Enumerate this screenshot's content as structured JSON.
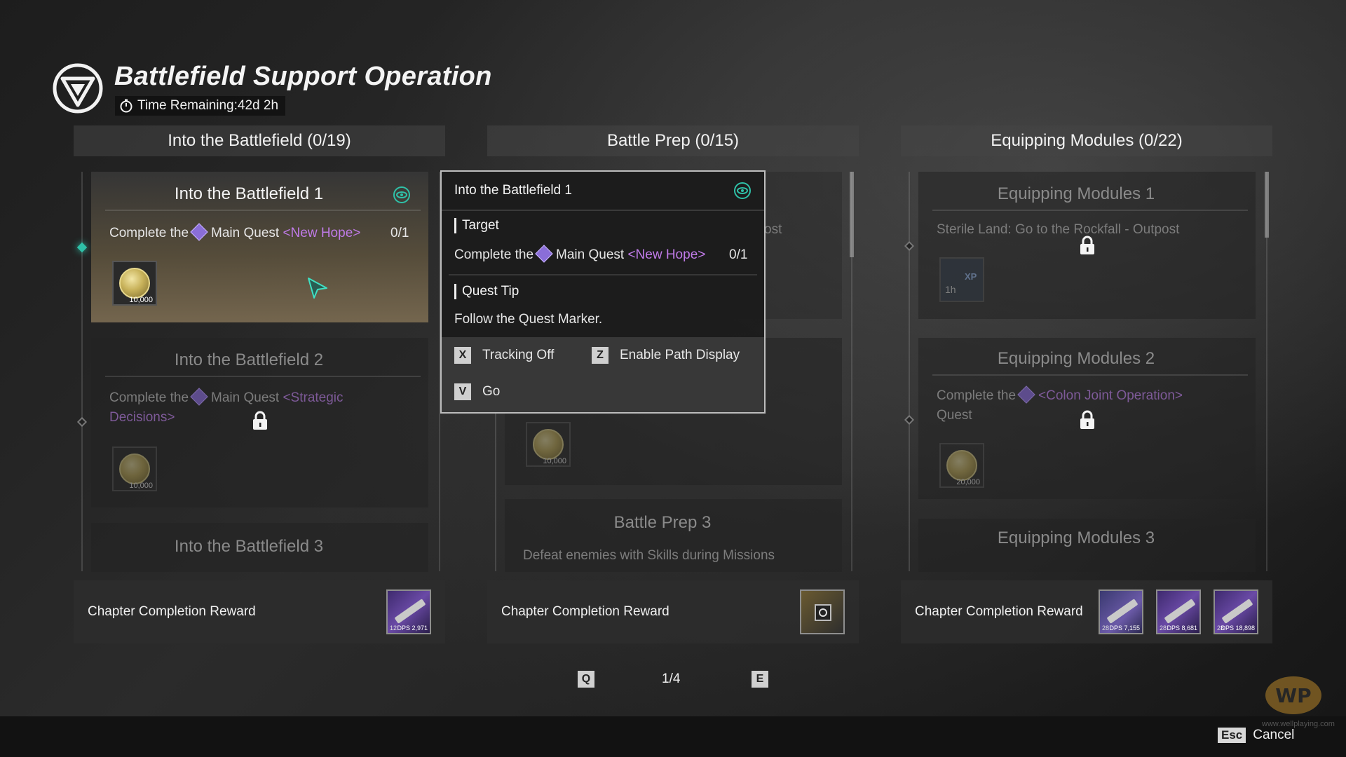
{
  "header": {
    "title": "Battlefield Support Operation",
    "time_remaining": "Time Remaining:42d 2h"
  },
  "columns": [
    {
      "title": "Into the Battlefield  (0/19)",
      "cards": [
        {
          "title": "Into the Battlefield 1",
          "desc_prefix": "Complete the",
          "quest_type": "Main Quest",
          "quest_name": "<New Hope>",
          "progress": "0/1",
          "reward_amount": "10,000"
        },
        {
          "title": "Into the Battlefield 2",
          "desc_prefix": "Complete the",
          "quest_type": "Main Quest",
          "quest_name": "<Strategic",
          "quest_name_2": "Decisions>",
          "reward_amount": "10,000"
        },
        {
          "title": "Into the Battlefield 3"
        }
      ],
      "reward_label": "Chapter Completion Reward",
      "reward_items": [
        {
          "level": "12",
          "dps": "DPS 2,971",
          "color": "#6a4aa6"
        }
      ]
    },
    {
      "title": "Battle Prep  (0/15)",
      "cards": [
        {
          "desc_fragment": "ost",
          "reward_amount": "10,000"
        },
        {
          "title": "Battle Prep 3",
          "desc": "Defeat enemies with Skills during Missions"
        }
      ],
      "reward_label": "Chapter Completion Reward"
    },
    {
      "title": "Equipping Modules  (0/22)",
      "cards": [
        {
          "title": "Equipping Modules 1",
          "desc": "Sterile Land: Go to the Rockfall - Outpost",
          "reward_time": "1h",
          "reward_tag": "XP"
        },
        {
          "title": "Equipping Modules 2",
          "desc_prefix": "Complete the",
          "quest_name": "<Colon Joint Operation>",
          "desc_suffix": "Quest",
          "reward_amount": "20,000"
        },
        {
          "title": "Equipping Modules 3"
        }
      ],
      "reward_label": "Chapter Completion Reward",
      "reward_items": [
        {
          "level": "28",
          "dps": "DPS 7,155"
        },
        {
          "level": "28",
          "dps": "DPS 8,681"
        },
        {
          "level": "28",
          "dps": "DPS 18,898"
        }
      ]
    }
  ],
  "popup": {
    "title": "Into the Battlefield 1",
    "target_label": "Target",
    "target_prefix": "Complete the",
    "target_quest_type": "Main Quest",
    "target_quest_name": "<New Hope>",
    "target_progress": "0/1",
    "tip_label": "Quest Tip",
    "tip_text": "Follow the Quest Marker.",
    "actions": [
      {
        "key": "X",
        "label": "Tracking Off"
      },
      {
        "key": "Z",
        "label": "Enable Path Display"
      },
      {
        "key": "V",
        "label": "Go"
      }
    ]
  },
  "pager": {
    "prev_key": "Q",
    "page": "1/4",
    "next_key": "E"
  },
  "footer": {
    "esc_key": "Esc",
    "cancel_label": "Cancel",
    "watermark": "WP",
    "watermark_site": "www.wellplaying.com"
  },
  "colors": {
    "accent_teal": "#2fc1a8",
    "quest_purple": "#c07be8",
    "popup_border": "#bdbdbd"
  }
}
